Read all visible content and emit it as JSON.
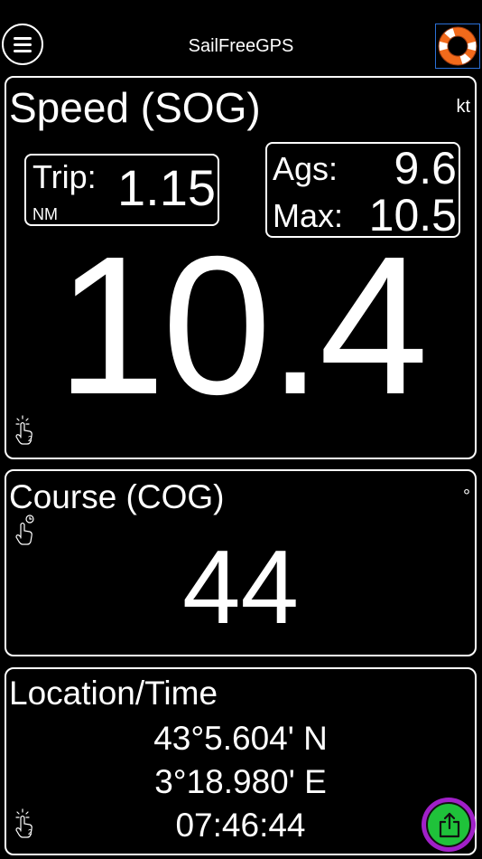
{
  "header": {
    "app_title": "SailFreeGPS"
  },
  "speed": {
    "title": "Speed (SOG)",
    "unit": "kt",
    "trip_label": "Trip:",
    "trip_value": "1.15",
    "trip_unit": "NM",
    "ags_label": "Ags:",
    "ags_value": "9.6",
    "max_label": "Max:",
    "max_value": "10.5",
    "value": "10.4",
    "touch_badge": "2"
  },
  "course": {
    "title": "Course (COG)",
    "unit": "°",
    "value": "44"
  },
  "location": {
    "title": "Location/Time",
    "latitude": "43°5.604' N",
    "longitude": "3°18.980' E",
    "time": "07:46:44",
    "touch_badge": "2"
  },
  "icons": {
    "menu": "menu-icon",
    "lifebuoy": "lifebuoy-icon",
    "touch_double": "double-tap-icon",
    "touch_hold": "tap-hold-icon",
    "share": "share-icon"
  },
  "colors": {
    "background": "#000000",
    "foreground": "#ffffff",
    "share_ring": "#a020c8",
    "share_fill": "#1fc23a",
    "lifebuoy_orange": "#f26a1b",
    "lifebuoy_selection": "#2b6fd6"
  }
}
